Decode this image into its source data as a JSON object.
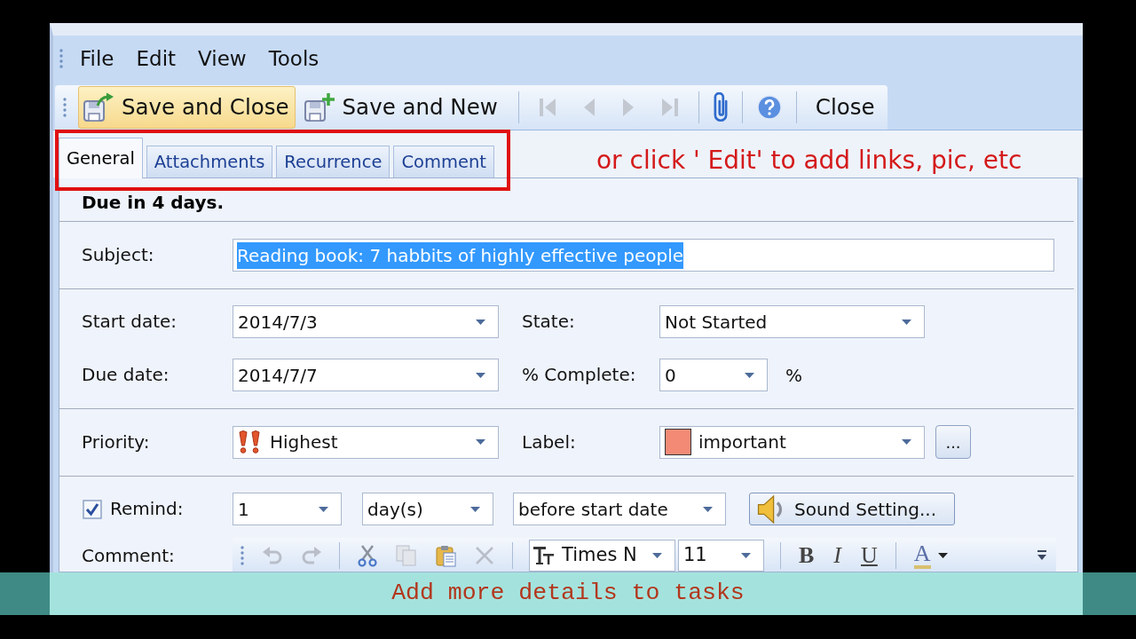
{
  "menu": [
    {
      "label": "File"
    },
    {
      "label": "Edit"
    },
    {
      "label": "View"
    },
    {
      "label": "Tools"
    }
  ],
  "toolbar": {
    "buttons": [
      {
        "label": "Save and Close",
        "hovered": true
      },
      {
        "label": "Save and New",
        "hovered": false
      }
    ],
    "navigation": [
      {
        "disabled": true
      },
      {
        "disabled": true
      },
      {
        "disabled": true
      },
      {
        "disabled": true
      }
    ],
    "close": {
      "label": "Close"
    }
  },
  "tabs": [
    {
      "label": "General",
      "selected": true
    },
    {
      "label": "Attachments",
      "selected": false
    },
    {
      "label": "Recurrence",
      "selected": false
    },
    {
      "label": "Comment",
      "selected": false
    }
  ],
  "annotation": {
    "text": "or click ' Edit' to add links, pic, etc"
  },
  "status": {
    "text": "Due in 4 days."
  },
  "form": {
    "subject": {
      "label": "Subject:",
      "value": "Reading book: 7 habbits of highly effective people",
      "text_selected": true
    },
    "start_date": {
      "label": "Start date:",
      "value": "2014/7/3"
    },
    "state": {
      "label": "State:",
      "value": "Not Started"
    },
    "due_date": {
      "label": "Due date:",
      "value": "2014/7/7"
    },
    "complete": {
      "label": "% Complete:",
      "value": "0",
      "unit": "%"
    },
    "priority": {
      "label": "Priority:",
      "value": "Highest"
    },
    "label": {
      "label": "Label:",
      "value": "important",
      "color": "#f28a76",
      "more_button": "..."
    },
    "remind": {
      "label": "Remind:",
      "checked": true,
      "amount": "1",
      "unit": "day(s)",
      "relative_to": "before start date",
      "sound_button": "Sound Setting..."
    },
    "comment": {
      "label": "Comment:",
      "toolbar": {
        "actions": [
          {
            "kind": "undo",
            "disabled": true
          },
          {
            "kind": "redo",
            "disabled": true
          },
          {
            "kind": "cut",
            "disabled": false
          },
          {
            "kind": "copy",
            "disabled": true
          },
          {
            "kind": "paste",
            "disabled": false
          },
          {
            "kind": "delete",
            "disabled": true
          }
        ],
        "font": "Times N",
        "size": "11",
        "formats": [
          {
            "kind": "bold",
            "label": "B"
          },
          {
            "kind": "italic",
            "label": "I"
          },
          {
            "kind": "underline",
            "label": "U"
          }
        ],
        "font_color": {
          "label": "A"
        }
      }
    }
  },
  "caption": {
    "text": "Add more details to tasks"
  }
}
